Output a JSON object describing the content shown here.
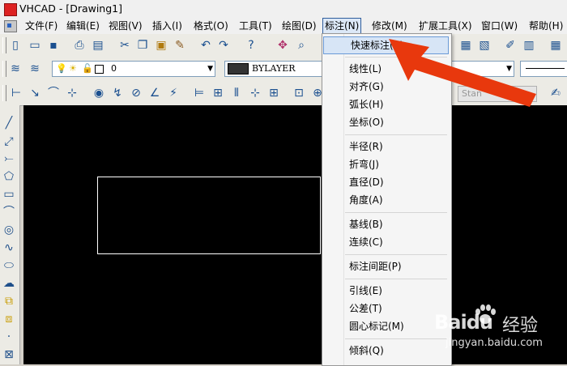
{
  "window": {
    "title": "VHCAD - [Drawing1]"
  },
  "menubar": {
    "items": [
      {
        "label": "文件(F)"
      },
      {
        "label": "编辑(E)"
      },
      {
        "label": "视图(V)"
      },
      {
        "label": "插入(I)"
      },
      {
        "label": "格式(O)"
      },
      {
        "label": "工具(T)"
      },
      {
        "label": "绘图(D)"
      },
      {
        "label": "标注(N)"
      },
      {
        "label": "修改(M)"
      },
      {
        "label": "扩展工具(X)"
      },
      {
        "label": "窗口(W)"
      },
      {
        "label": "帮助(H)"
      }
    ],
    "active": "标注(N)"
  },
  "layer_toolbar": {
    "layer_value": "0",
    "color_value": "BYLAYER",
    "text_style": "Stan"
  },
  "dimension_menu": {
    "items": [
      {
        "label": "快速标注(K)",
        "highlighted": true
      },
      {
        "label": "线性(L)"
      },
      {
        "label": "对齐(G)"
      },
      {
        "label": "弧长(H)"
      },
      {
        "label": "坐标(O)"
      },
      {
        "label": "半径(R)"
      },
      {
        "label": "折弯(J)"
      },
      {
        "label": "直径(D)"
      },
      {
        "label": "角度(A)"
      },
      {
        "label": "基线(B)"
      },
      {
        "label": "连续(C)"
      },
      {
        "label": "标注间距(P)"
      },
      {
        "label": "引线(E)"
      },
      {
        "label": "公差(T)"
      },
      {
        "label": "圆心标记(M)"
      },
      {
        "label": "倾斜(Q)"
      }
    ]
  },
  "watermark": {
    "brand": "Baidu",
    "brand_cn": "经验",
    "url": "jingyan.baidu.com"
  },
  "colors": {
    "canvas": "#000000",
    "arrow": "#e8380d",
    "menu_highlight": "#d7e5f6"
  }
}
